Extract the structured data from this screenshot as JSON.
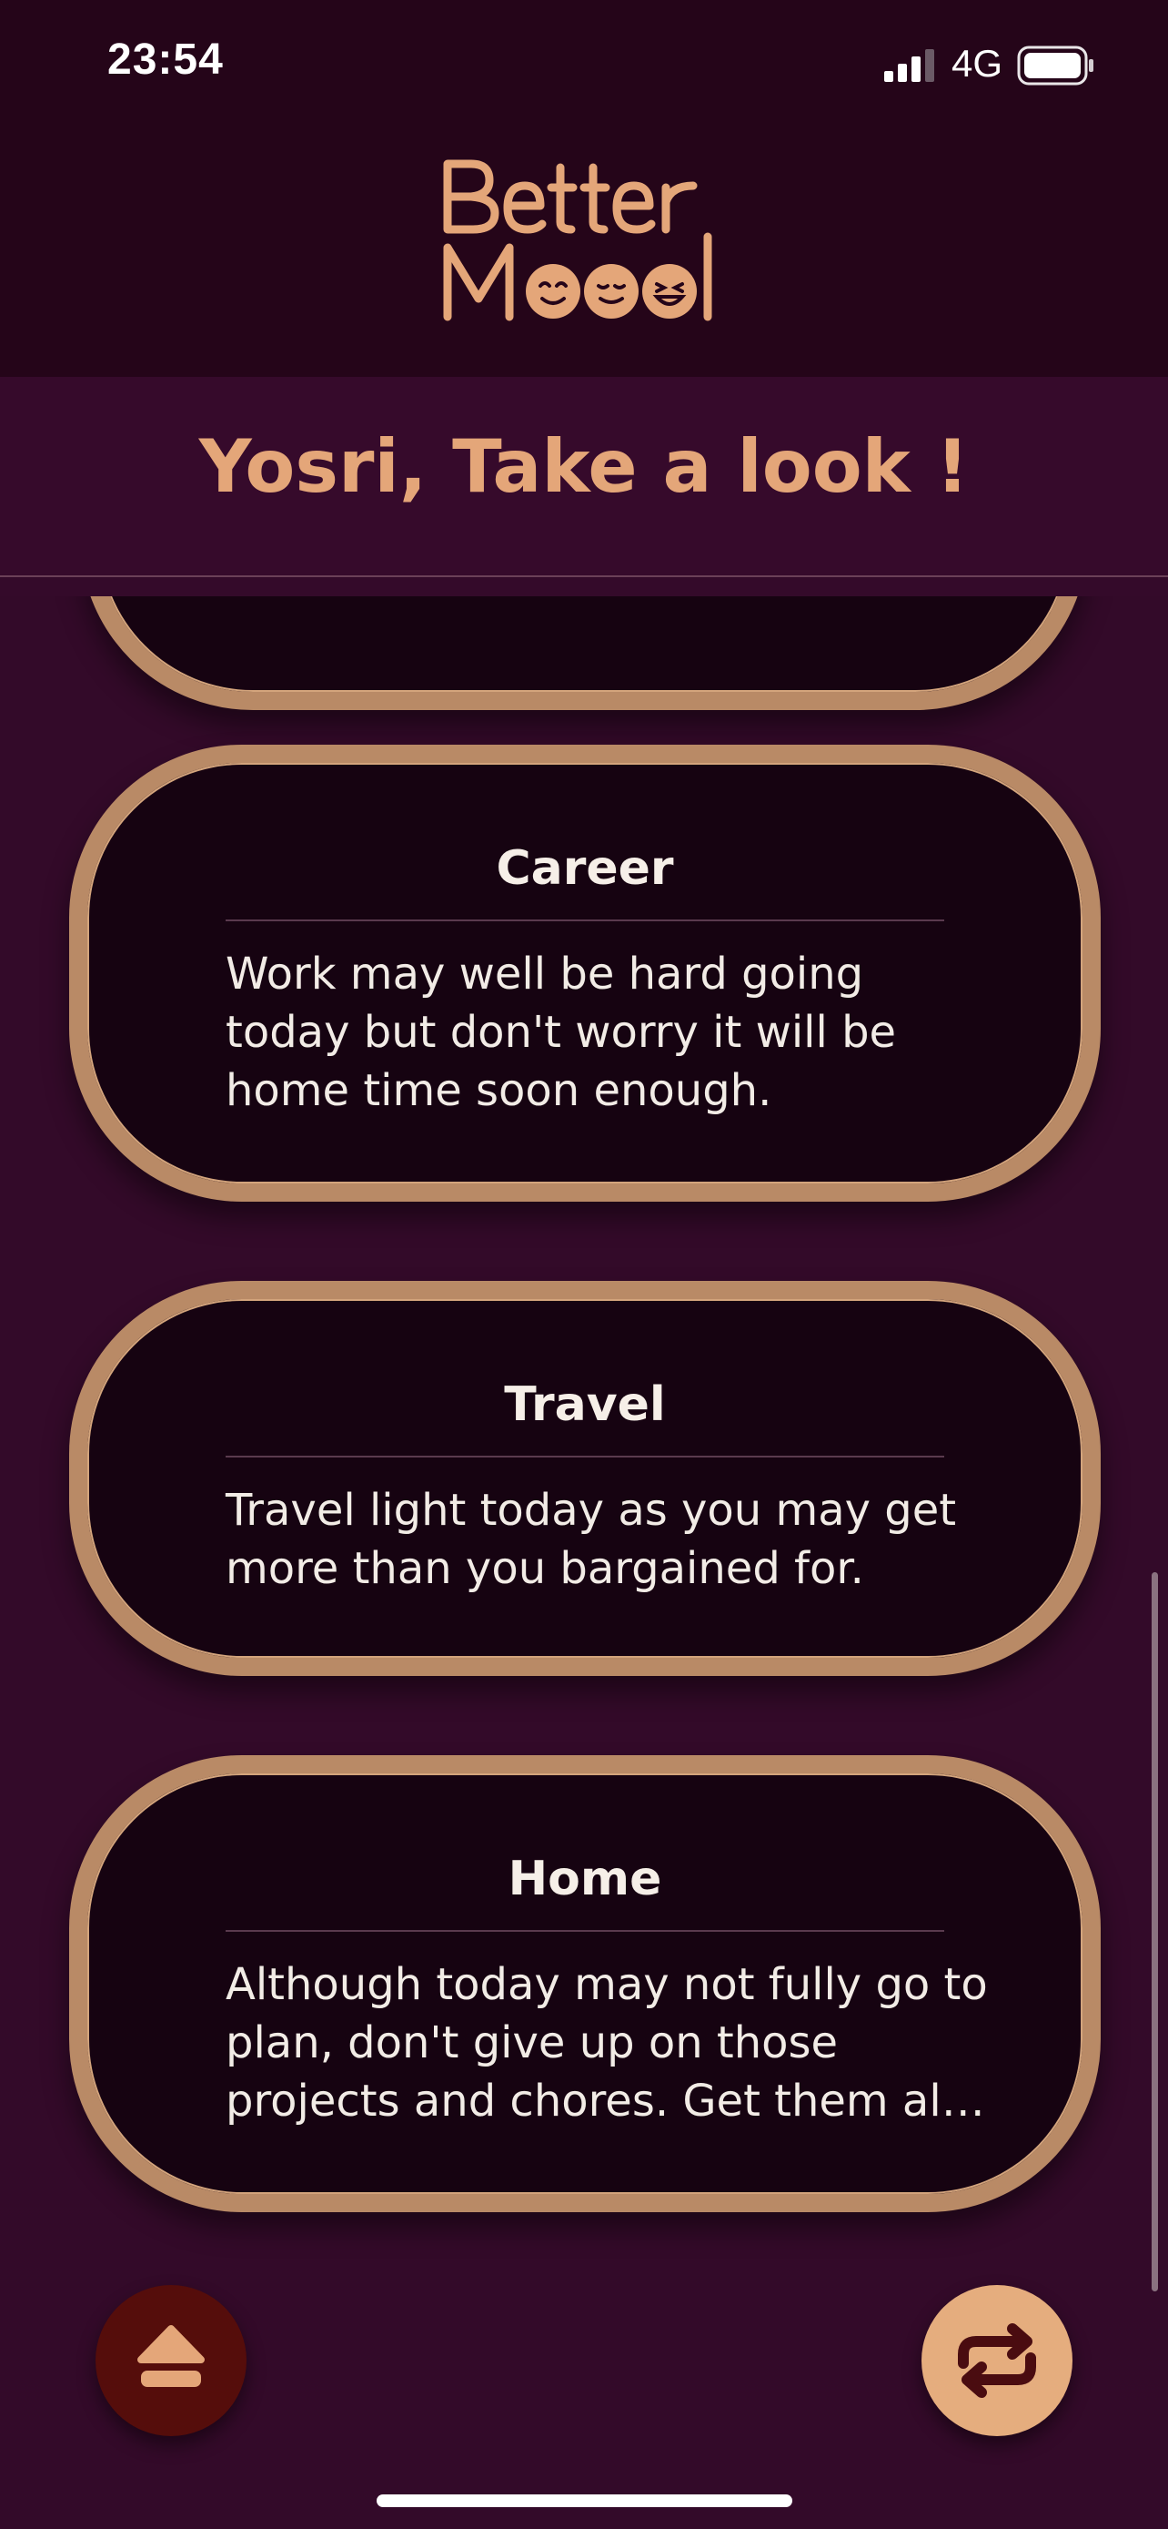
{
  "status_bar": {
    "time": "23:54",
    "network": "4G",
    "signal_icon": "cellular-signal-icon",
    "battery_icon": "battery-icon"
  },
  "header": {
    "logo_icon": "better-mood-logo",
    "logo_text": "Better Mood"
  },
  "greeting": {
    "title": "Yosri, Take a look !"
  },
  "cards": [
    {
      "title": "Career",
      "text": "Work may well be hard going today but don't worry it will be home time soon enough."
    },
    {
      "title": "Travel",
      "text": "Travel light today as you may get more than you bargained for."
    },
    {
      "title": "Home",
      "text": "Although today may not fully go to plan, don't give up on those projects and chores. Get them all completed t..."
    }
  ],
  "buttons": {
    "eject_icon": "eject-icon",
    "repeat_icon": "repeat-icon"
  },
  "colors": {
    "background": "#330a29",
    "header": "#250519",
    "accent": "#e4a679",
    "card_fill": "#160311",
    "card_border": "#b98a66",
    "eject_button": "#550d0b",
    "repeat_button": "#e5ad7e"
  }
}
